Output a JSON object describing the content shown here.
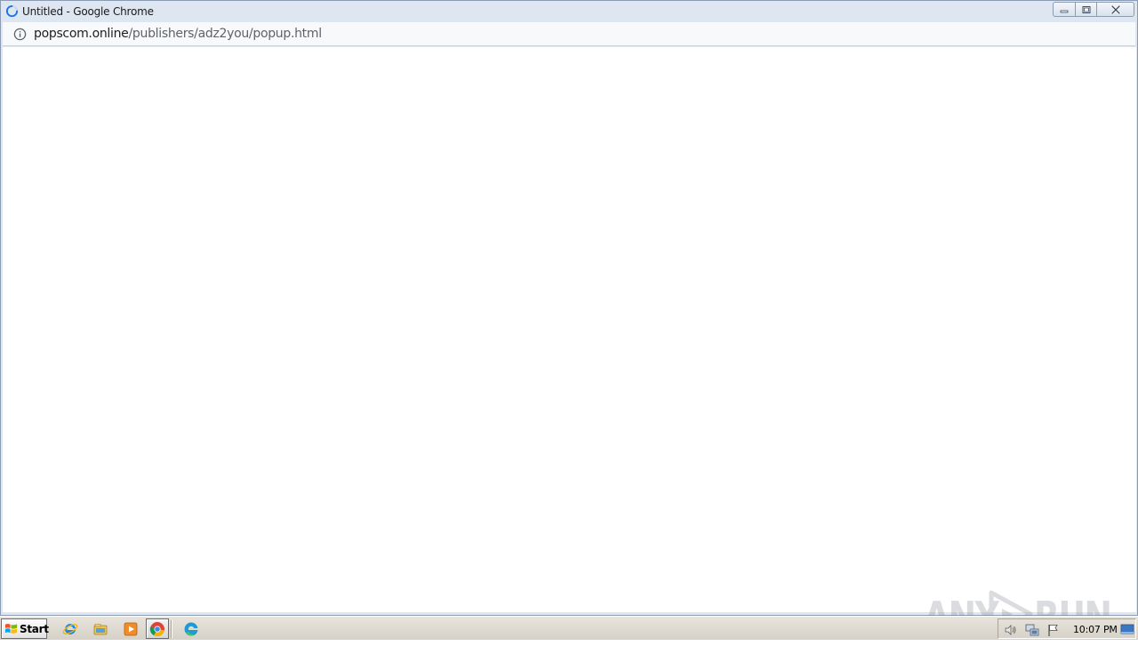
{
  "window": {
    "title": "Untitled - Google Chrome",
    "icons": {
      "app": "loading-spinner-icon",
      "minimize": "minimize-icon",
      "maximize": "restore-icon",
      "close": "close-icon"
    }
  },
  "addressbar": {
    "info_icon": "info-icon",
    "url_host": "popscom.online",
    "url_path": "/publishers/adz2you/popup.html"
  },
  "watermark": {
    "left": "ANY",
    "right": "RUN"
  },
  "taskbar": {
    "start_label": "Start",
    "pinned": [
      {
        "name": "internet-explorer-icon"
      },
      {
        "name": "file-explorer-icon"
      },
      {
        "name": "media-player-icon"
      },
      {
        "name": "chrome-icon",
        "active": true
      },
      {
        "name": "edge-icon"
      }
    ],
    "tray": {
      "icons": [
        "speaker-icon",
        "network-icon",
        "action-center-flag-icon"
      ],
      "clock": "10:07 PM"
    }
  },
  "colors": {
    "accent": "#1a73e8",
    "titlebar": "#dee6f1",
    "taskbar": "#d6d1c7"
  }
}
